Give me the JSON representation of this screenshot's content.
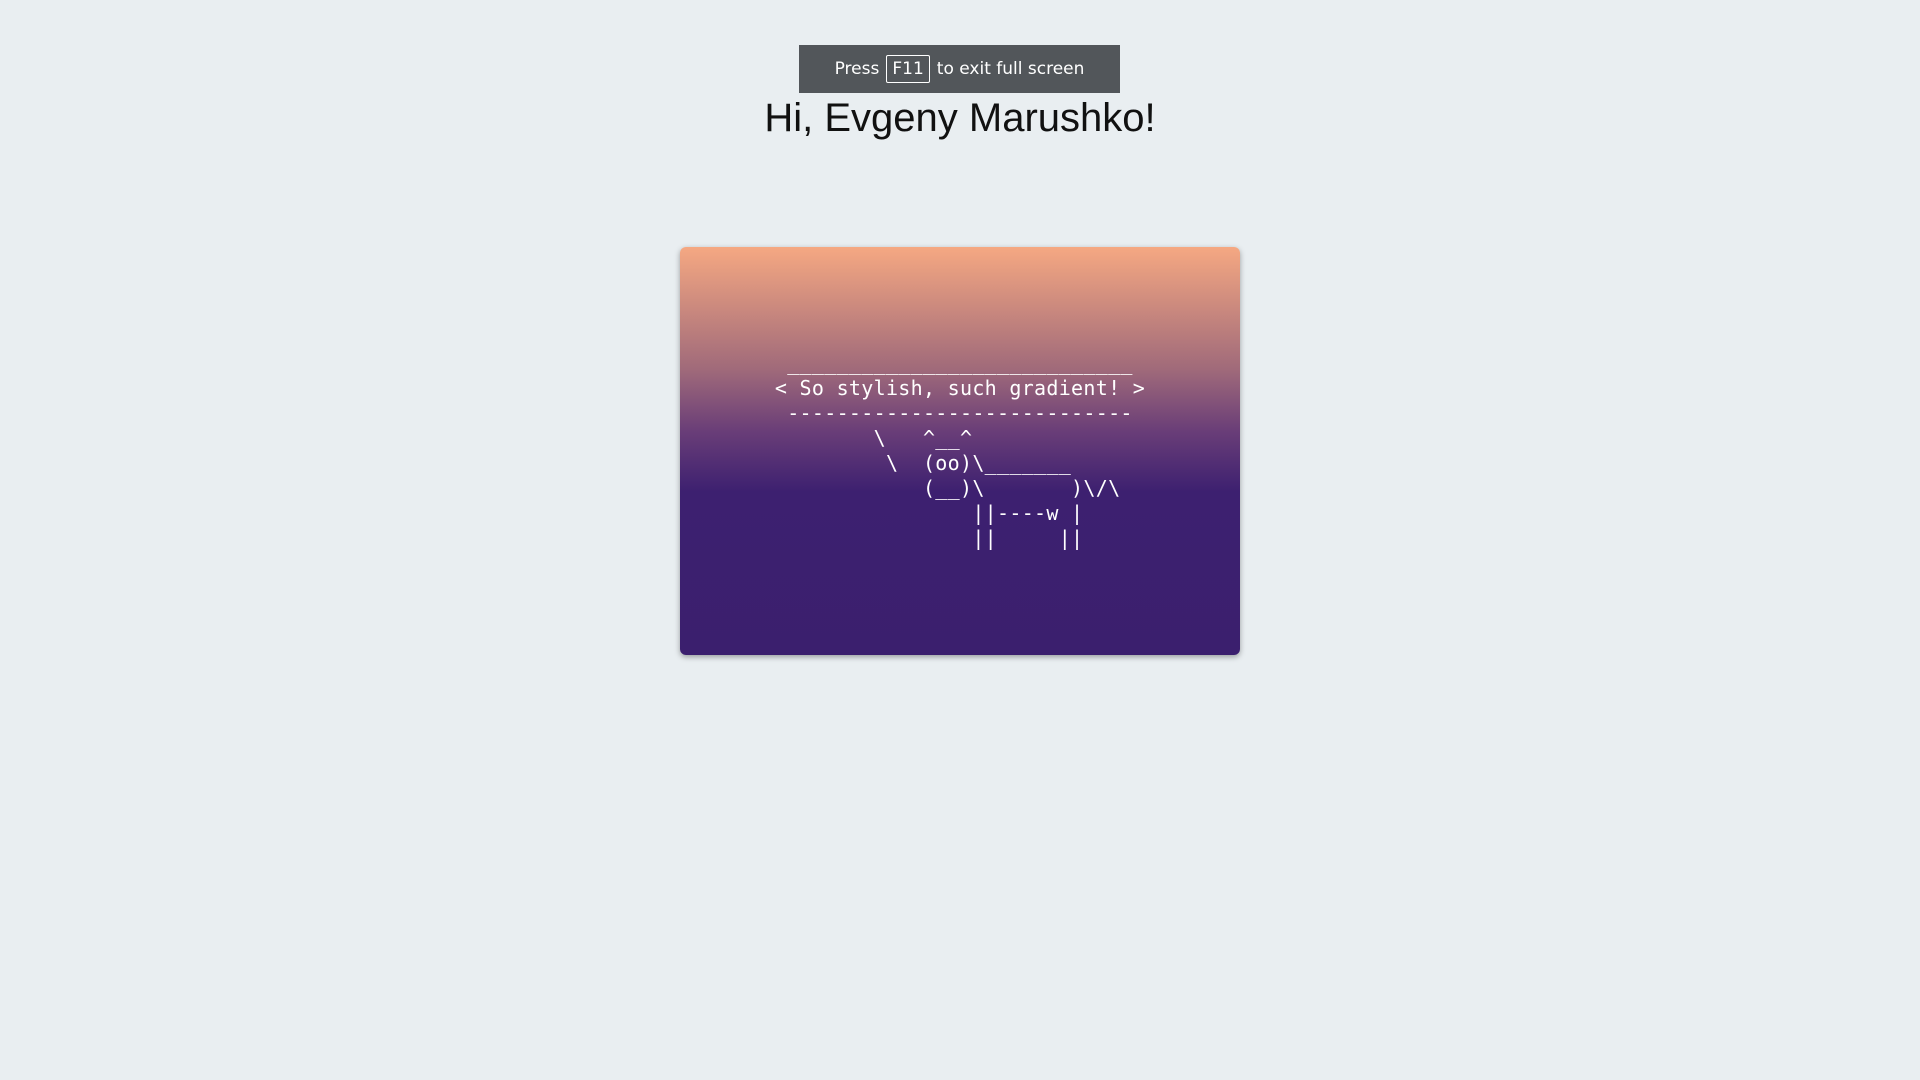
{
  "fullscreen_notice": {
    "prefix": "Press",
    "key": "F11",
    "suffix": "to exit full screen"
  },
  "greeting": "Hi, Evgeny Marushko!",
  "card": {
    "ascii_art": " ____________________________\n< So stylish, such gradient! >\n ----------------------------\n        \\   ^__^\n         \\  (oo)\\_______\n            (__)\\       )\\/\\\n                ||----w |\n                ||     ||"
  }
}
